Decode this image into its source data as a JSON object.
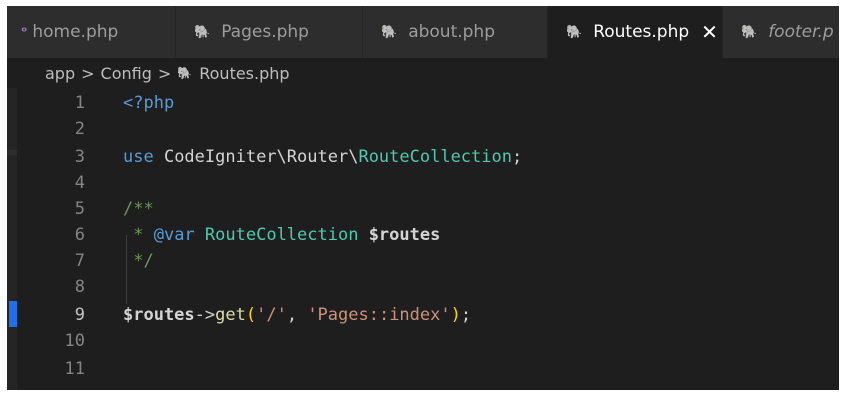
{
  "tabs": [
    {
      "icon": "php-elephant-icon",
      "label": "home.php",
      "active": false
    },
    {
      "icon": "php-elephant-icon",
      "label": "Pages.php",
      "active": false
    },
    {
      "icon": "php-elephant-icon",
      "label": "about.php",
      "active": false
    },
    {
      "icon": "php-elephant-icon",
      "label": "Routes.php",
      "active": true,
      "close": "✕"
    },
    {
      "icon": "php-elephant-icon",
      "label": "footer.p",
      "active": false,
      "italic": true
    }
  ],
  "breadcrumb": {
    "items": [
      "app",
      "Config",
      "Routes.php"
    ],
    "separator": ">"
  },
  "editor": {
    "lines": [
      {
        "n": "1"
      },
      {
        "n": "2"
      },
      {
        "n": "3"
      },
      {
        "n": "4"
      },
      {
        "n": "5"
      },
      {
        "n": "6"
      },
      {
        "n": "7"
      },
      {
        "n": "8"
      },
      {
        "n": "9"
      },
      {
        "n": "10"
      },
      {
        "n": "11"
      }
    ],
    "tokens": {
      "l1_open": "<?php",
      "l3_use": "use",
      "l3_ns1": " CodeIgniter\\",
      "l3_ns2": "Router",
      "l3_ns3": "\\",
      "l3_class": "RouteCollection",
      "l3_semi": ";",
      "l5_comment": "/**",
      "l6_star": " * ",
      "l6_tag": "@var",
      "l6_space": " ",
      "l6_class": "RouteCollection",
      "l6_var": " $routes",
      "l7_comment": " */",
      "l9_var": "$routes",
      "l9_arrow": "->",
      "l9_func": "get",
      "l9_open": "(",
      "l9_str1": "'/'",
      "l9_comma": ", ",
      "l9_str2": "'Pages::index'",
      "l9_close": ")",
      "l9_semi": ";"
    },
    "current_line": 9
  },
  "colors": {
    "background": "#1e1e1e",
    "tab_inactive": "#2d2d2d",
    "php_icon": "#a074c4",
    "keyword": "#569cd6",
    "class": "#4ec9b0",
    "string": "#ce9178",
    "function": "#dcdcaa",
    "variable": "#9cdcfe",
    "comment": "#6a9955"
  }
}
